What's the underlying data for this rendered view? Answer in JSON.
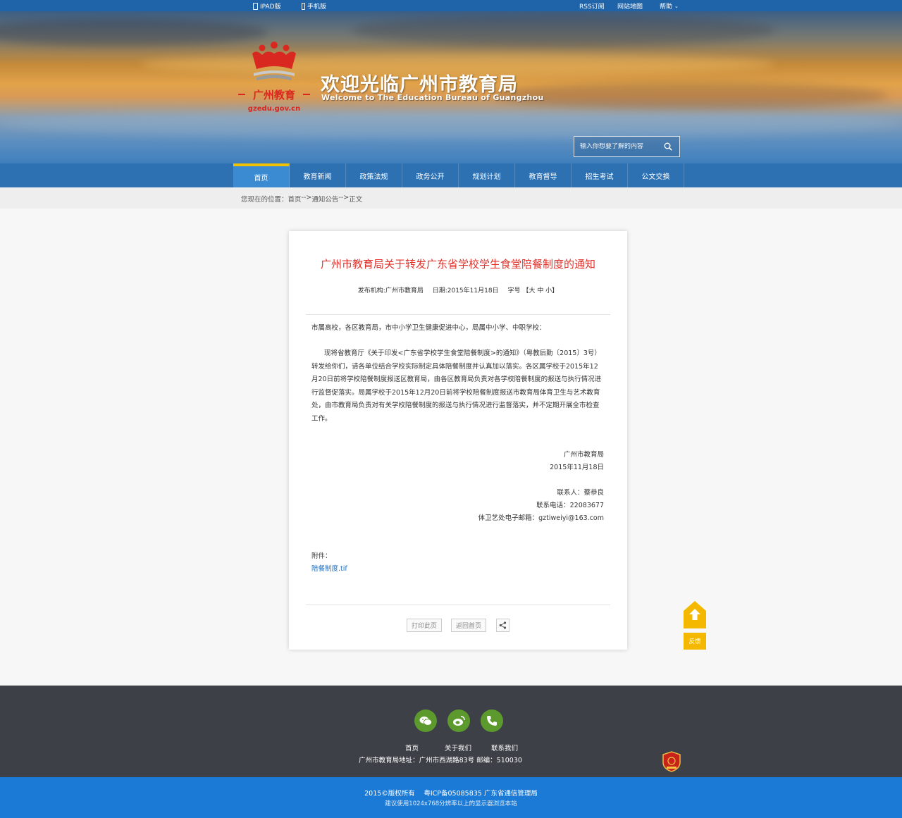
{
  "topbar": {
    "ipad": "IPAD版",
    "mobile": "手机版",
    "rss": "RSS订阅",
    "sitemap": "网站地图",
    "help": "帮助"
  },
  "header": {
    "logo_text": "广州教育",
    "logo_domain": "gzedu.gov.cn",
    "title": "欢迎光临广州市教育局",
    "subtitle": "Welcome to The Education Bureau of Guangzhou",
    "search_placeholder": "输入你想要了解的内容"
  },
  "nav": {
    "items": [
      "首页",
      "教育新闻",
      "政策法规",
      "政务公开",
      "规划计划",
      "教育督导",
      "招生考试",
      "公文交换"
    ],
    "active": 0
  },
  "breadcrumb": {
    "label": "您现在的位置：",
    "home": "首页",
    "sep1": "-->",
    "section": "通知公告",
    "sep2": "-->",
    "current": "正文"
  },
  "article": {
    "title": "广州市教育局关于转发广东省学校学生食堂陪餐制度的通知",
    "publisher": "发布机构:广州市教育局",
    "date": "日期:2015年11月18日",
    "font_label": "字号",
    "font_sizes": "【大 中 小】",
    "salutation": "市属高校，各区教育局，市中小学卫生健康促进中心，局属中小学、中职学校：",
    "body": "现将省教育厅《关于印发<广东省学校学生食堂陪餐制度>的通知》（粤教后勤〔2015〕3号）转发给你们，请各单位结合学校实际制定具体陪餐制度并认真加以落实。各区属学校于2015年12月20日前将学校陪餐制度报送区教育局，由各区教育局负责对各学校陪餐制度的报送与执行情况进行监督促落实。局属学校于2015年12月20日前将学校陪餐制度报送市教育局体育卫生与艺术教育处，由市教育局负责对有关学校陪餐制度的报送与执行情况进行监督落实，并不定期开展全市检查工作。",
    "sign_org": "广州市教育局",
    "sign_date": "2015年11月18日",
    "contact_person": "联系人：蔡恭良",
    "contact_phone": "联系电话：22083677",
    "contact_email": "体卫艺处电子邮箱：gztiweiyi@163.com",
    "attach_label": "附件：",
    "attach_file": "陪餐制度.tif",
    "print_btn": "打印此页",
    "back_btn": "返回首页"
  },
  "float": {
    "feedback": "反馈"
  },
  "footer": {
    "links": [
      "首页",
      "关于我们",
      "联系我们"
    ],
    "address": "广州市教育局地址：广州市西湖路83号 邮编：510030",
    "copyright": "2015©版权所有　 粤ICP备05085835 广东省通信管理局",
    "advice": "建议使用1024x768分辨率以上的显示器浏览本站"
  },
  "colors": {
    "title_red": "#e0312a",
    "nav_blue": "#2d71b3",
    "accent_yellow": "#f2c200",
    "footer_dark": "#3d4147",
    "copyright_blue": "#1a7ad6",
    "social_green": "#5c9a2e"
  }
}
